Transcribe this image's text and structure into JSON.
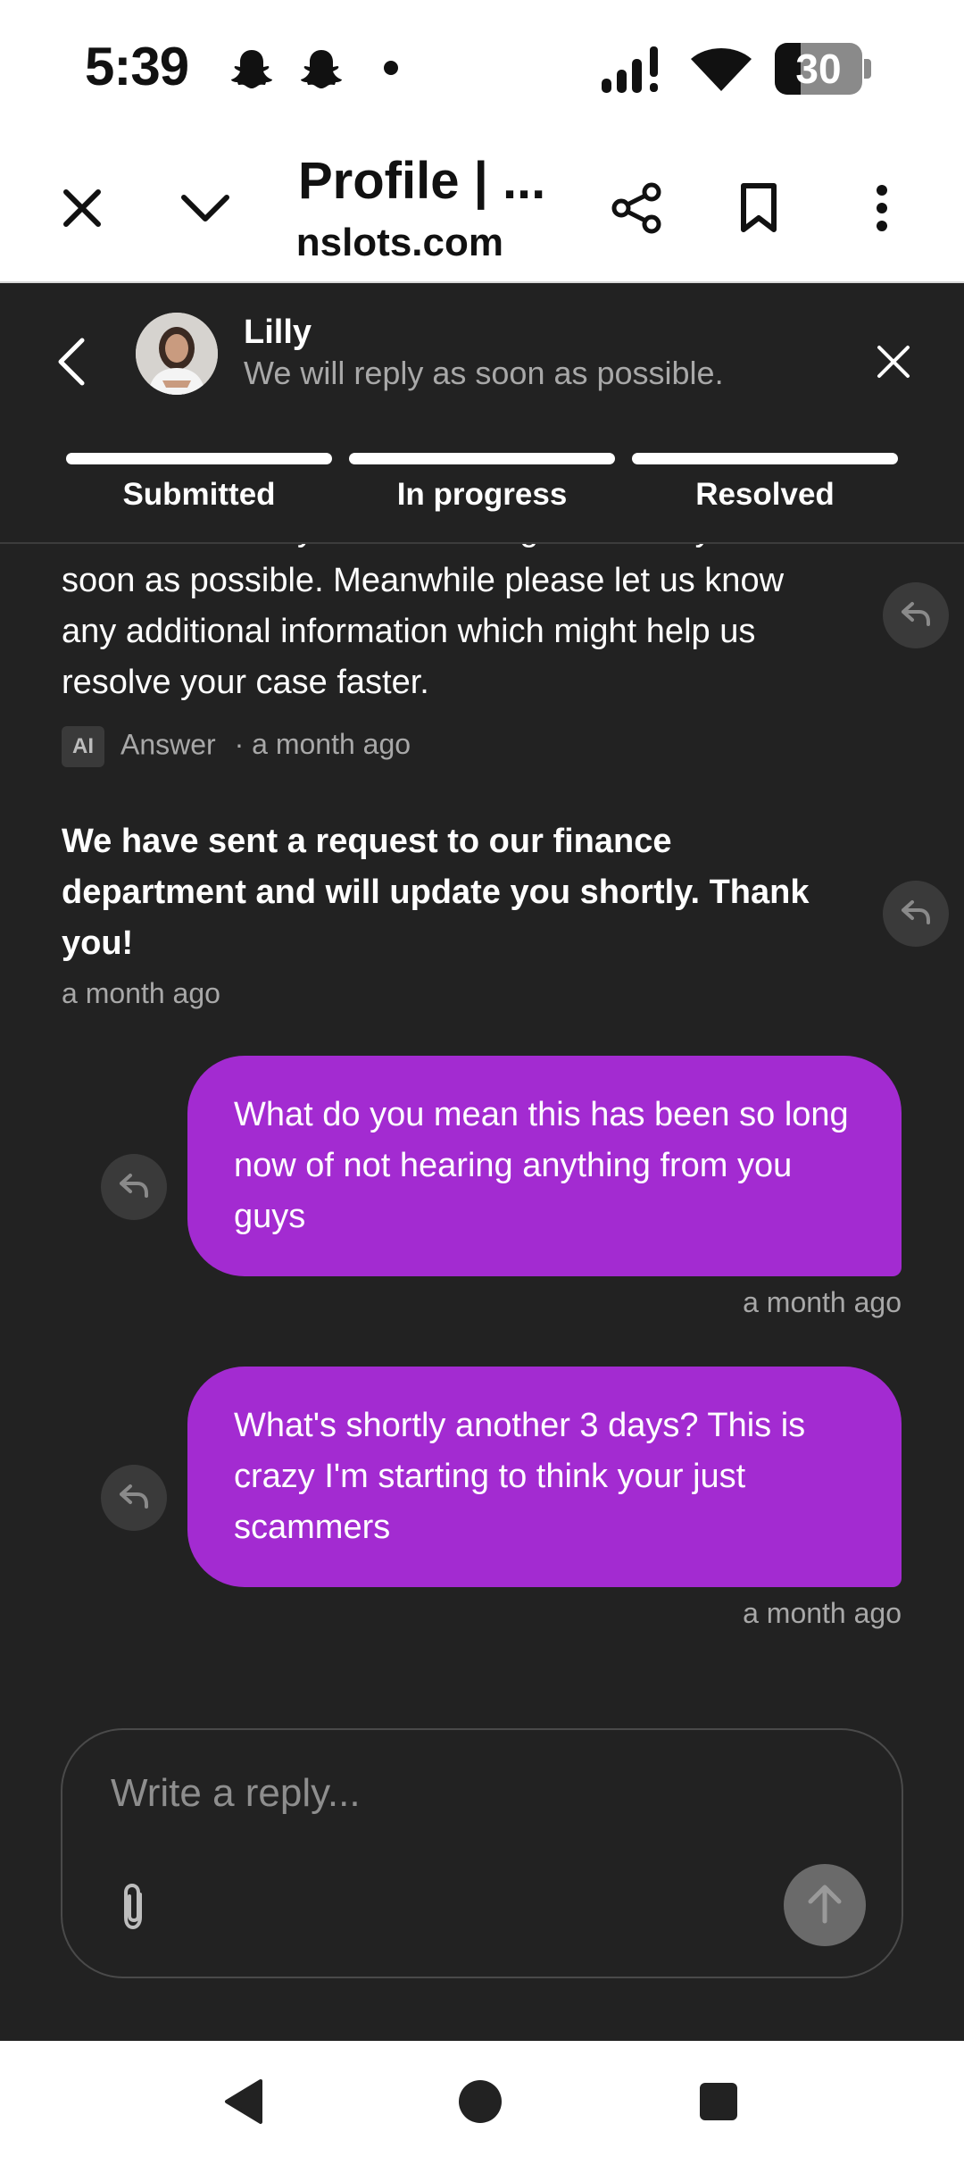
{
  "status_bar": {
    "time": "5:39",
    "icons": [
      "snapchat-icon",
      "snapchat-icon",
      "notification-dot",
      "signal-icon",
      "wifi-icon"
    ],
    "battery_percent": "30",
    "battery_level": 0.3
  },
  "browser": {
    "page_title": "Profile | ...",
    "url_fragment": "nslots.com",
    "icons": [
      "close-icon",
      "chevron-down-icon",
      "share-icon",
      "bookmark-icon",
      "more-vert-icon"
    ]
  },
  "chat_header": {
    "agent_name": "Lilly",
    "agent_status": "We will reply as soon as possible.",
    "steps": [
      {
        "label": "Submitted",
        "complete": true
      },
      {
        "label": "In progress",
        "complete": true
      },
      {
        "label": "Resolved",
        "complete": true
      }
    ]
  },
  "messages": {
    "m1": {
      "partial_top_line": "who will review your case and get back to you as",
      "text": "soon as possible. Meanwhile please let us know any additional information which might help us resolve your case faster.",
      "badge": "AI",
      "source": "Answer",
      "time": "· a month ago"
    },
    "m2": {
      "text": "We have sent a request to our finance department and will update you shortly. Thank you!",
      "time": "a month ago"
    },
    "m3": {
      "text": "What do you mean this has been so long now of not hearing anything from you guys",
      "time": "a month ago"
    },
    "m4": {
      "text": "What's shortly another 3 days? This is crazy I'm starting to think your just scammers",
      "time": "a month ago"
    }
  },
  "composer": {
    "placeholder": "Write a reply...",
    "value": ""
  },
  "colors": {
    "background": "#222222",
    "bubble": "#a32bd1",
    "muted_text": "#a8a8a8"
  }
}
